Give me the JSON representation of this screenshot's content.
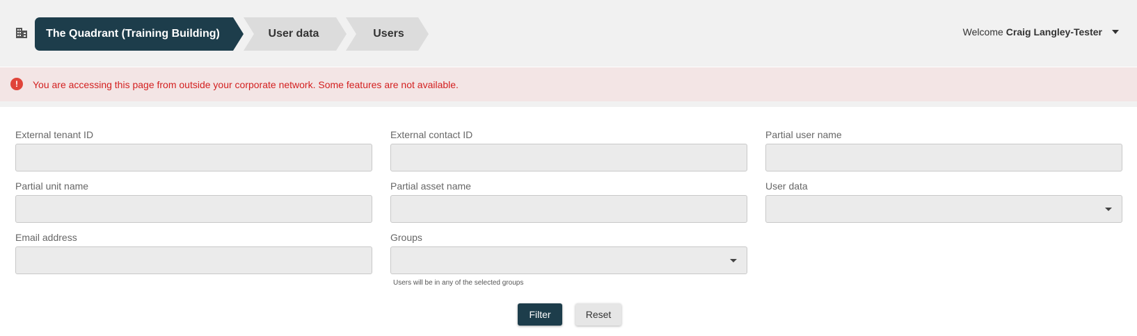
{
  "breadcrumb": {
    "items": [
      {
        "label": "The Quadrant (Training Building)"
      },
      {
        "label": "User data"
      },
      {
        "label": "Users"
      }
    ]
  },
  "header": {
    "welcome_prefix": "Welcome",
    "user_name": "Craig Langley-Tester"
  },
  "alert": {
    "icon": "!",
    "message": "You are accessing this page from outside your corporate network. Some features are not available."
  },
  "form": {
    "external_tenant_id": {
      "label": "External tenant ID",
      "value": ""
    },
    "external_contact_id": {
      "label": "External contact ID",
      "value": ""
    },
    "partial_user_name": {
      "label": "Partial user name",
      "value": ""
    },
    "partial_unit_name": {
      "label": "Partial unit name",
      "value": ""
    },
    "partial_asset_name": {
      "label": "Partial asset name",
      "value": ""
    },
    "user_data": {
      "label": "User data",
      "value": ""
    },
    "email_address": {
      "label": "Email address",
      "value": ""
    },
    "groups": {
      "label": "Groups",
      "value": "",
      "helper": "Users will be in any of the selected groups"
    }
  },
  "actions": {
    "filter_label": "Filter",
    "reset_label": "Reset"
  },
  "colors": {
    "primary": "#1d3d4b",
    "alert_bg": "#f3e5e5",
    "alert_text": "#d31f1f"
  }
}
